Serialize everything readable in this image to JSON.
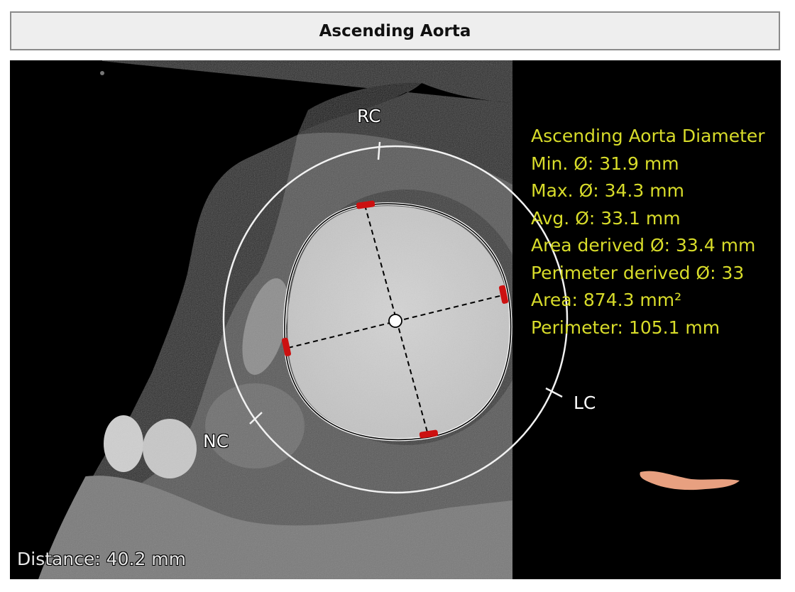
{
  "header": {
    "title": "Ascending Aorta"
  },
  "measurements": {
    "lines": [
      "Ascending Aorta Diameter",
      "Min. Ø: 31.9 mm",
      "Max. Ø: 34.3 mm",
      "Avg. Ø: 33.1 mm",
      "Area derived Ø: 33.4 mm",
      "Perimeter derived Ø: 33",
      "Area: 874.3 mm²",
      "Perimeter: 105.1 mm"
    ]
  },
  "labels": {
    "rc": "RC",
    "lc": "LC",
    "nc": "NC"
  },
  "footer": {
    "distance": "Distance: 40.2 mm"
  },
  "colors": {
    "measurement_text": "#d8dc2a",
    "marker": "#cc1111",
    "orientation_model": "#e8a080"
  }
}
